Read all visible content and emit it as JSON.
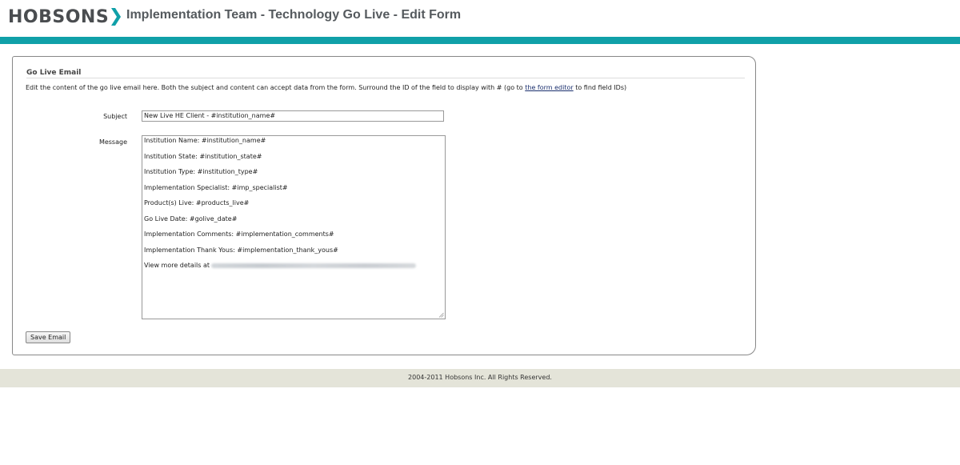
{
  "header": {
    "logo_text": "HOBSONS",
    "page_title": "Implementation Team - Technology Go Live - Edit Form"
  },
  "colors": {
    "accent_bar": "#10a0a8",
    "logo_chevron": "#10a0a8",
    "footer_bg": "#e4e4d9"
  },
  "section": {
    "title": "Go Live Email",
    "intro_before_link": "Edit the content of the go live email here. Both the subject and content can accept data from the form. Surround the ID of the field to display with # (go to ",
    "intro_link": "the form editor",
    "intro_after_link": " to find field IDs)"
  },
  "form": {
    "subject_label": "Subject",
    "subject_value": "New Live HE Client - #institution_name#",
    "message_label": "Message",
    "message_lines": [
      "Institution Name: #institution_name#",
      "Institution State: #institution_state#",
      "Institution Type: #institution_type#",
      "Implementation Specialist: #imp_specialist#",
      "Product(s) Live: #products_live#",
      "Go Live Date: #golive_date#",
      "Implementation Comments: #implementation_comments#",
      "Implementation Thank Yous: #implementation_thank_yous#",
      "View more details at"
    ],
    "save_label": "Save Email"
  },
  "footer": {
    "copyright": "2004-2011 Hobsons Inc. All Rights Reserved."
  }
}
